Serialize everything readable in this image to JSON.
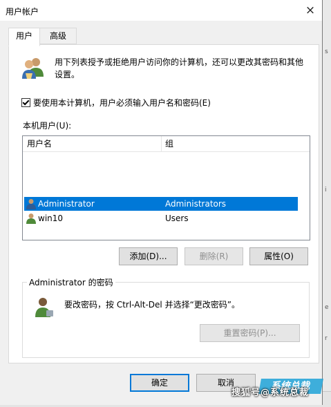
{
  "window": {
    "title": "用户帐户",
    "close_icon": "×"
  },
  "tabs": [
    {
      "label": "用户",
      "active": true
    },
    {
      "label": "高级",
      "active": false
    }
  ],
  "description": "用下列表授予或拒绝用户访问你的计算机，还可以更改其密码和其他设置。",
  "require_login": {
    "label": "要使用本计算机，用户必须输入用户名和密码(E)",
    "checked": true
  },
  "local_users": {
    "label": "本机用户(U):",
    "columns": [
      "用户名",
      "组"
    ],
    "rows": [
      {
        "name": "Administrator",
        "group": "Administrators",
        "selected": true
      },
      {
        "name": "win10",
        "group": "Users",
        "selected": false
      }
    ]
  },
  "buttons": {
    "add": "添加(D)...",
    "remove": "删除(R)",
    "properties": "属性(O)"
  },
  "password_group": {
    "title": "Administrator 的密码",
    "text": "要改密码，按 Ctrl-Alt-Del 并选择“更改密码”。",
    "reset_button": "重置密码(P)..."
  },
  "footer": {
    "ok": "确定",
    "cancel": "取消"
  },
  "watermark": {
    "text": "搜狐号@系统总裁",
    "logo": "系统总裁"
  },
  "colors": {
    "selection": "#0078d7",
    "accent": "#0078d7"
  }
}
